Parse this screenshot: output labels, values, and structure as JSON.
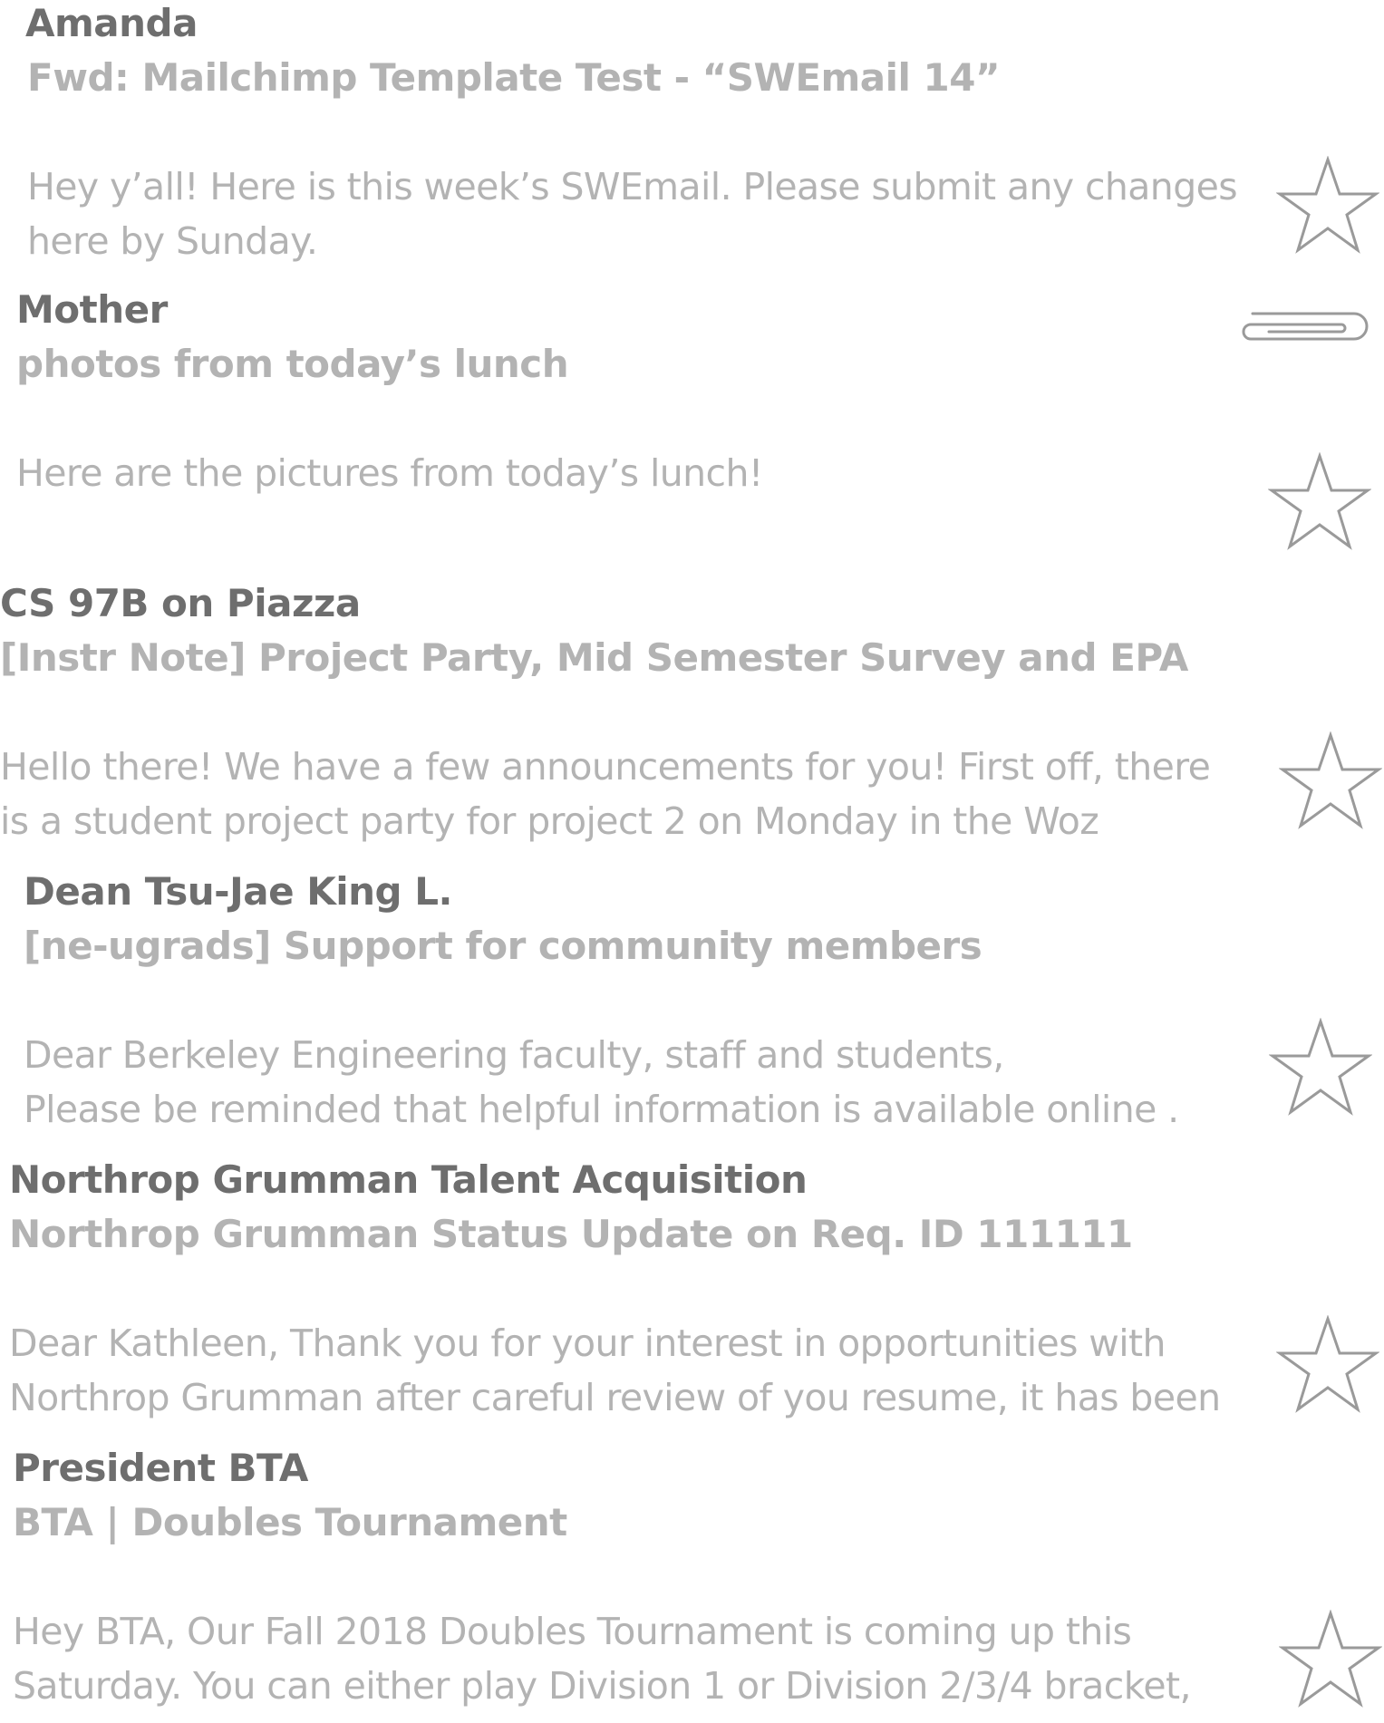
{
  "emails": [
    {
      "sender": "Amanda",
      "subject": "Fwd: Mailchimp Template Test - “SWEmail 14”",
      "preview_line1": "Hey y’all! Here is this week’s SWEmail. Please submit any changes",
      "preview_line2": "here by Sunday.",
      "icon": "star-icon"
    },
    {
      "sender": "Mother",
      "subject": "photos from today’s lunch",
      "preview_line1": "Here are the pictures from today’s lunch!",
      "preview_line2": "",
      "icon": "star-icon",
      "attachment_icon": "paperclip-icon"
    },
    {
      "sender": "CS 97B on Piazza",
      "subject": "[Instr Note] Project Party, Mid Semester Survey and EPA",
      "preview_line1": "Hello there! We have a few announcements for you! First off, there",
      "preview_line2": "is a student project party for project 2 on Monday in the Woz",
      "icon": "star-icon"
    },
    {
      "sender": "Dean Tsu-Jae King L.",
      "subject": "[ne-ugrads] Support for community members",
      "preview_line1": "Dear Berkeley Engineering faculty, staff and students,",
      "preview_line2": "Please be reminded that helpful information is available online .",
      "icon": "star-icon"
    },
    {
      "sender": "Northrop Grumman Talent Acquisition",
      "subject": "Northrop Grumman Status Update on Req. ID 111111",
      "preview_line1": "Dear Kathleen, Thank you for your interest in opportunities with",
      "preview_line2": "Northrop Grumman after careful review of you resume, it has been",
      "icon": "star-icon"
    },
    {
      "sender": "President BTA",
      "subject": "BTA | Doubles Tournament",
      "preview_line1": "Hey BTA, Our Fall 2018 Doubles Tournament is coming up this",
      "preview_line2": "Saturday. You can either play Division 1 or Division 2/3/4 bracket,",
      "icon": "star-icon"
    }
  ],
  "colors": {
    "sender": "#6e6e6e",
    "muted": "#b3b3b3",
    "icon_stroke": "#9a9a9a"
  }
}
